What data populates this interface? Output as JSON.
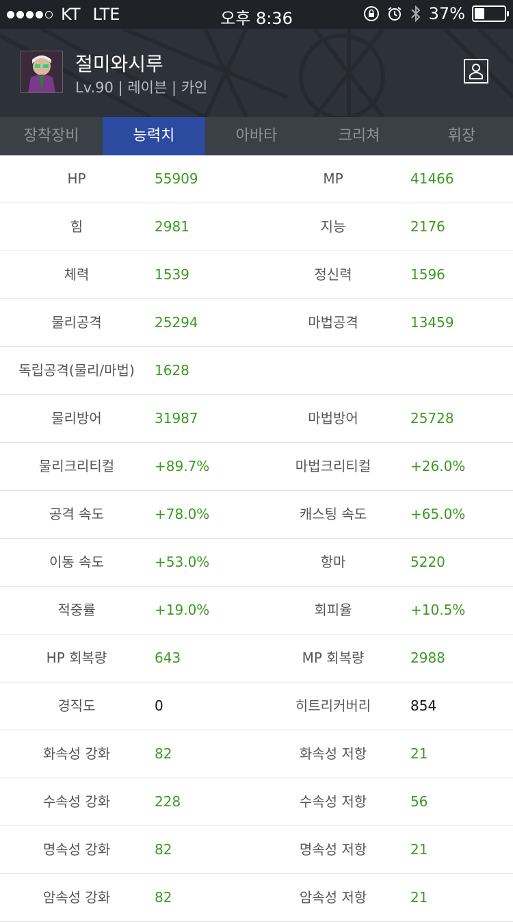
{
  "status_bar": {
    "carrier": "KT",
    "network": "LTE",
    "time": "오후 8:36",
    "battery": "37%",
    "battery_level": 0.37
  },
  "header": {
    "character_name": "절미와시루",
    "character_meta": "Lv.90 | 레이븐 | 카인"
  },
  "tabs": [
    {
      "label": "장착장비"
    },
    {
      "label": "능력치"
    },
    {
      "label": "아바타"
    },
    {
      "label": "크리쳐"
    },
    {
      "label": "휘장"
    }
  ],
  "active_tab": "능력치",
  "stats": [
    {
      "l_label": "HP",
      "l_value": "55909",
      "r_label": "MP",
      "r_value": "41466"
    },
    {
      "l_label": "힘",
      "l_value": "2981",
      "r_label": "지능",
      "r_value": "2176"
    },
    {
      "l_label": "체력",
      "l_value": "1539",
      "r_label": "정신력",
      "r_value": "1596"
    },
    {
      "l_label": "물리공격",
      "l_value": "25294",
      "r_label": "마법공격",
      "r_value": "13459"
    },
    {
      "l_label": "독립공격(물리/마법)",
      "l_value": "1628",
      "r_label": "",
      "r_value": ""
    },
    {
      "l_label": "물리방어",
      "l_value": "31987",
      "r_label": "마법방어",
      "r_value": "25728"
    },
    {
      "l_label": "물리크리티컬",
      "l_value": "+89.7%",
      "r_label": "마법크리티컬",
      "r_value": "+26.0%"
    },
    {
      "l_label": "공격 속도",
      "l_value": "+78.0%",
      "r_label": "캐스팅 속도",
      "r_value": "+65.0%"
    },
    {
      "l_label": "이동 속도",
      "l_value": "+53.0%",
      "r_label": "항마",
      "r_value": "5220"
    },
    {
      "l_label": "적중률",
      "l_value": "+19.0%",
      "r_label": "회피율",
      "r_value": "+10.5%"
    },
    {
      "l_label": "HP 회복량",
      "l_value": "643",
      "r_label": "MP 회복량",
      "r_value": "2988"
    },
    {
      "l_label": "경직도",
      "l_value": "0",
      "r_label": "히트리커버리",
      "r_value": "854"
    },
    {
      "l_label": "화속성 강화",
      "l_value": "82",
      "r_label": "화속성 저항",
      "r_value": "21"
    },
    {
      "l_label": "수속성 강화",
      "l_value": "228",
      "r_label": "수속성 저항",
      "r_value": "56"
    },
    {
      "l_label": "명속성 강화",
      "l_value": "82",
      "r_label": "명속성 저항",
      "r_value": "21"
    },
    {
      "l_label": "암속성 강화",
      "l_value": "82",
      "r_label": "암속성 저항",
      "r_value": "21"
    }
  ],
  "colors": {
    "accent_tab": "#2c4aa0",
    "value_green": "#3a9a1f",
    "value_black": "#111111"
  },
  "icons": [
    "signal-dots-icon",
    "lock-rotation-icon",
    "alarm-icon",
    "bluetooth-icon",
    "battery-icon",
    "profile-icon"
  ]
}
